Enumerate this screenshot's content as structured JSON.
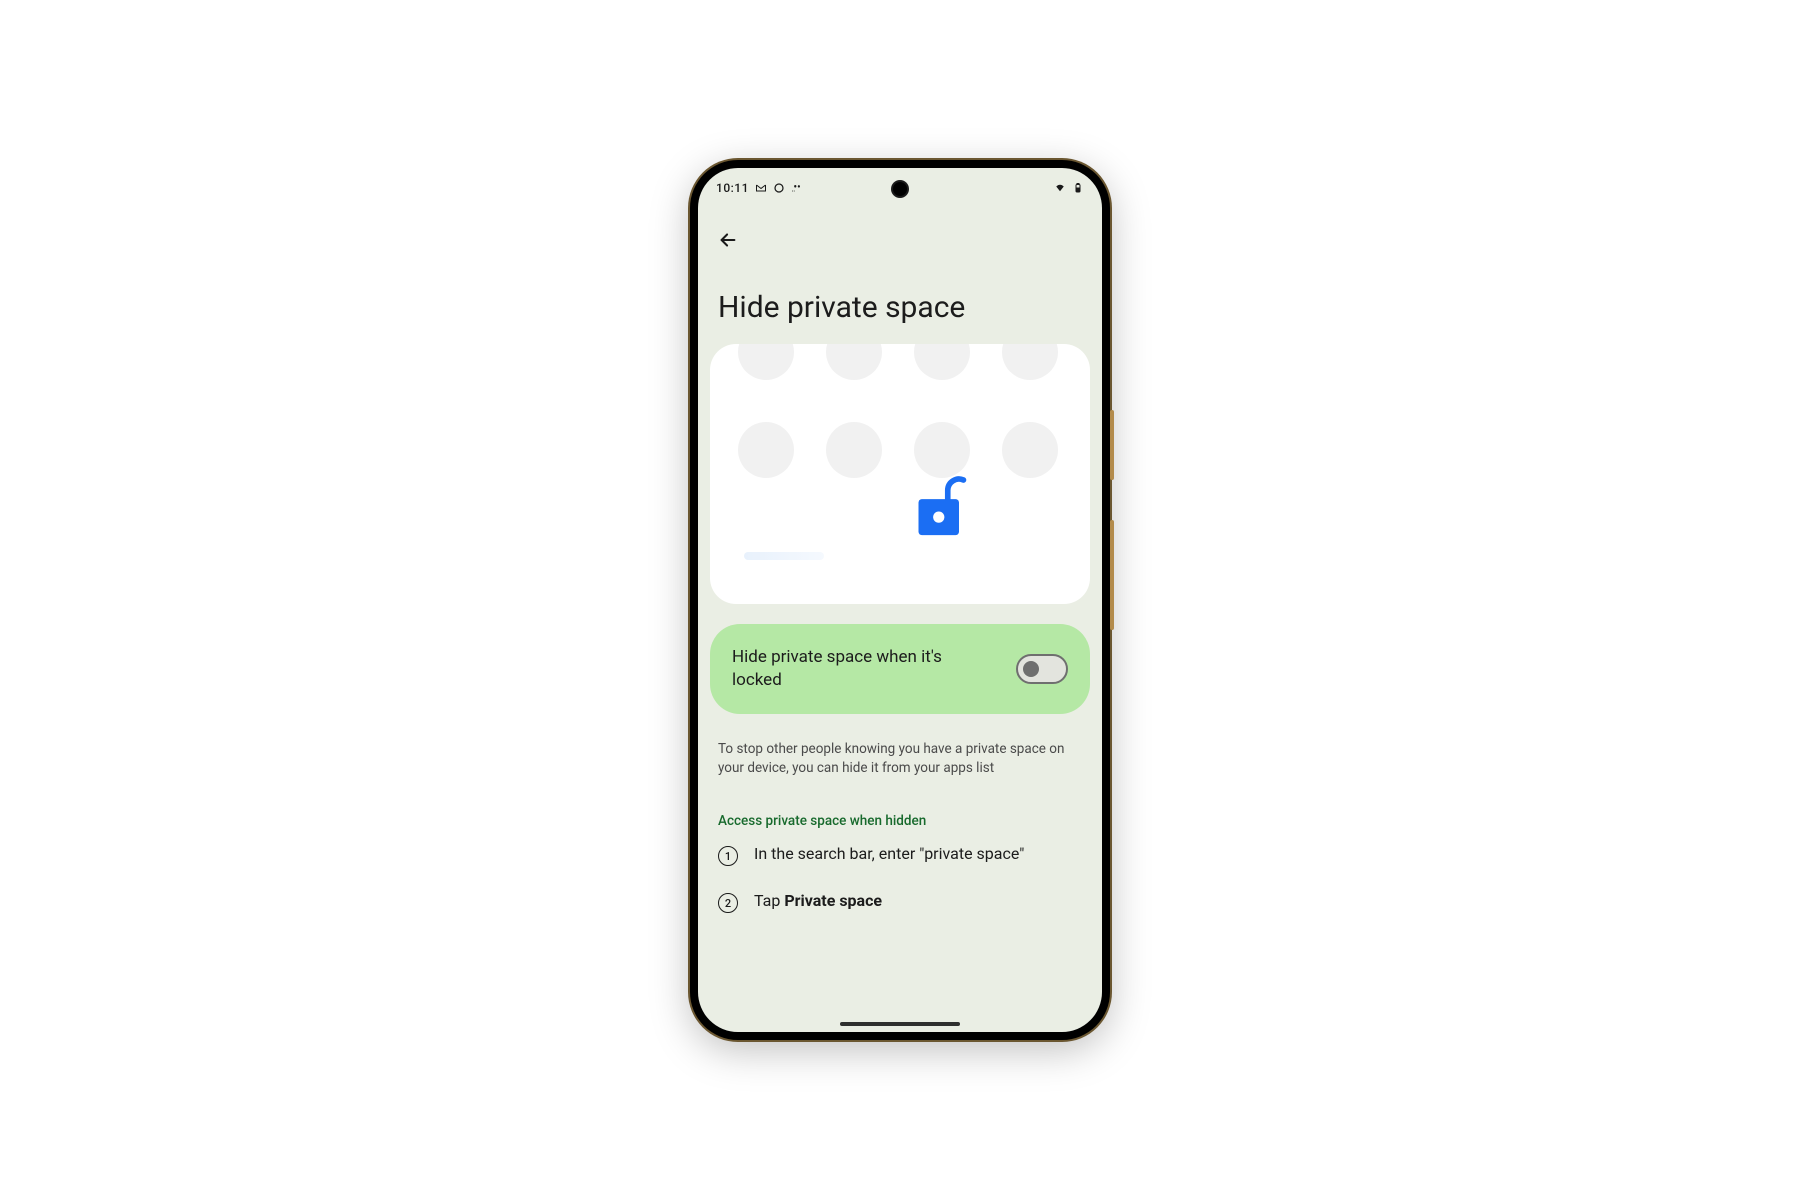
{
  "statusbar": {
    "time": "10:11"
  },
  "page": {
    "title": "Hide private space"
  },
  "toggle": {
    "label": "Hide private space when it's locked",
    "value": false
  },
  "description": "To stop other people knowing you have a private space on your device, you can hide it from your apps list",
  "section_heading": "Access private space when hidden",
  "steps": [
    {
      "num": "1",
      "text": "In the search bar, enter \"private space\""
    },
    {
      "num": "2",
      "prefix": "Tap ",
      "bold": "Private space"
    }
  ]
}
